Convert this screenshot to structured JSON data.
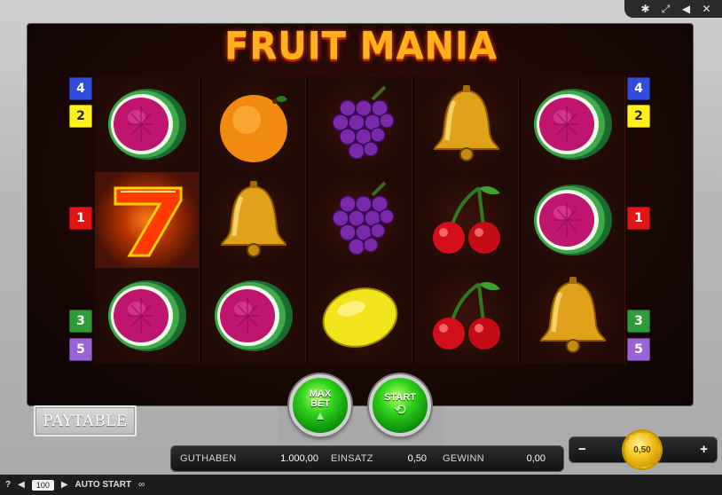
{
  "toolbar": {
    "settings_icon": "gear-icon",
    "fullscreen_icon": "fullscreen-icon",
    "sound_icon": "speaker-icon",
    "close_icon": "close-icon"
  },
  "game": {
    "title": "FRUIT MANIA",
    "reels": [
      [
        "melon",
        "seven",
        "melon"
      ],
      [
        "orange",
        "bell",
        "melon"
      ],
      [
        "grapes",
        "grapes",
        "lemon"
      ],
      [
        "bell",
        "cherry",
        "cherry"
      ],
      [
        "melon",
        "melon",
        "bell"
      ]
    ],
    "lines_left": [
      "4",
      "2",
      "1",
      "3",
      "5"
    ],
    "lines_right": [
      "4",
      "2",
      "1",
      "3",
      "5"
    ]
  },
  "controls": {
    "paytable_label": "PAYTABLE",
    "maxbet_label_1": "MAX",
    "maxbet_label_2": "BET",
    "start_label": "START",
    "minus_label": "−",
    "plus_label": "+",
    "coin_value": "0,50"
  },
  "status": {
    "guthaben_label": "GUTHABEN",
    "guthaben_value": "1.000,00",
    "einsatz_label": "EINSATZ",
    "einsatz_value": "0,50",
    "gewinn_label": "GEWINN",
    "gewinn_value": "0,00"
  },
  "footer": {
    "help_label": "?",
    "autostart_count": "100",
    "autostart_label": "AUTO START"
  }
}
